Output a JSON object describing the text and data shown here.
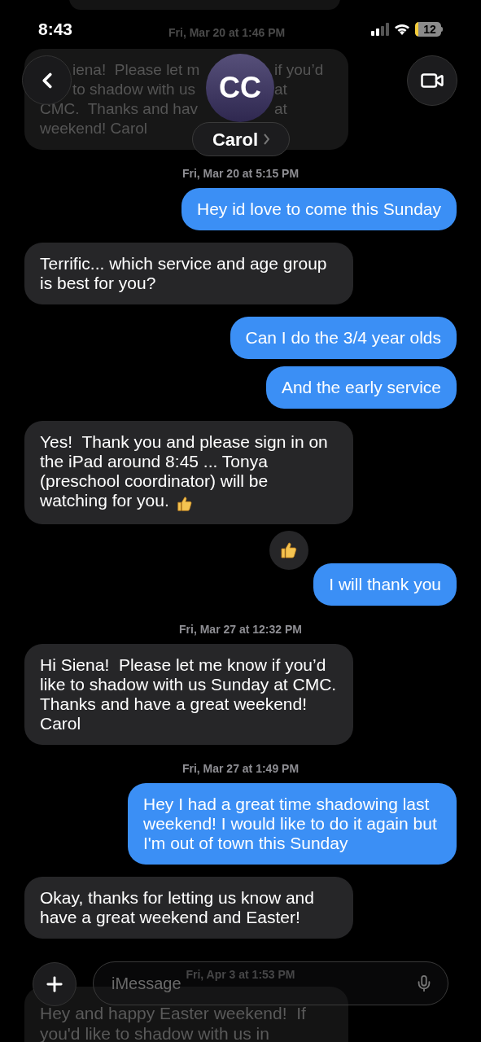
{
  "status_bar": {
    "time": "8:43",
    "battery": "12"
  },
  "header": {
    "avatar_initials": "CC",
    "contact_name": "Carol"
  },
  "top_faded_message": {
    "lines": [
      {
        "left": "iena!  Please let m",
        "right": "if you’d",
        "indent": true
      },
      {
        "left": "to shadow with us",
        "right": "at",
        "indent": true
      },
      {
        "left": "CMC.  Thanks and hav",
        "right": "at",
        "indent": false
      },
      {
        "left": "weekend! Carol",
        "indent": false
      }
    ]
  },
  "items": [
    {
      "kind": "date",
      "text": "Fri, Mar 20 at 1:46 PM",
      "faded": true
    },
    {
      "kind": "date",
      "text": "Fri, Mar 20 at 5:15 PM",
      "faded": false
    },
    {
      "kind": "message",
      "outgoing": true,
      "text": "Hey id love to come this Sunday"
    },
    {
      "kind": "message",
      "outgoing": false,
      "text": "Terrific... which service and age group is best for you?"
    },
    {
      "kind": "message",
      "outgoing": true,
      "text": "Can I do the 3/4 year olds"
    },
    {
      "kind": "message",
      "outgoing": true,
      "text": "And the early service"
    },
    {
      "kind": "message",
      "outgoing": false,
      "text": "Yes!  Thank you and please sign in on the iPad around 8:45 ... Tonya (preschool coordinator) will be watching for you.",
      "thumbs_up_emoji": true
    },
    {
      "kind": "message",
      "outgoing": true,
      "text": "I will thank you",
      "thumbs_up_tapback": true
    },
    {
      "kind": "date",
      "text": "Fri, Mar 27 at 12:32 PM",
      "faded": false
    },
    {
      "kind": "message",
      "outgoing": false,
      "text": "Hi Siena!  Please let me know if you’d like to shadow with us Sunday at CMC.  Thanks and have a great weekend! Carol"
    },
    {
      "kind": "date",
      "text": "Fri, Mar 27 at 1:49 PM",
      "faded": false
    },
    {
      "kind": "message",
      "outgoing": true,
      "text": "Hey I had a great time shadowing last weekend! I would like to do it again but I'm out of town this Sunday"
    },
    {
      "kind": "message",
      "outgoing": false,
      "text": "Okay, thanks for letting us know and have a great weekend and Easter!"
    }
  ],
  "bottom_faded": {
    "date": "Fri, Apr 3 at 1:53 PM",
    "message": "Hey and happy Easter weekend!  If you'd like to shadow with us in"
  },
  "composer": {
    "placeholder": "iMessage"
  }
}
